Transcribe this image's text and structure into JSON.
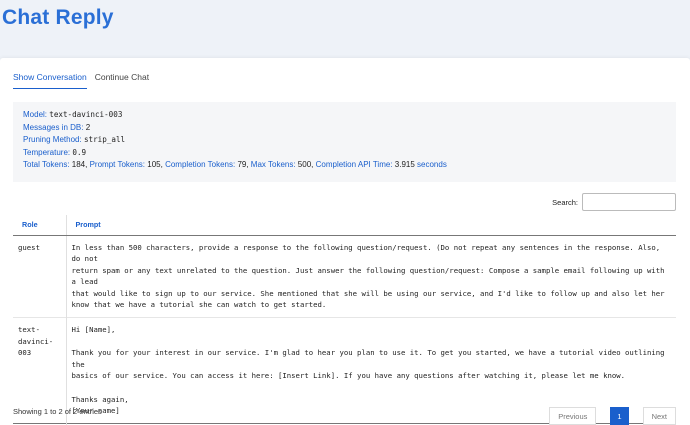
{
  "page": {
    "title": "Chat Reply"
  },
  "tabs": [
    {
      "label": "Show Conversation",
      "active": true
    },
    {
      "label": "Continue Chat",
      "active": false
    }
  ],
  "info": {
    "model_label": "Model:",
    "model_value": "text-davinci-003",
    "messages_label": "Messages in DB:",
    "messages_value": "2",
    "pruning_label": "Pruning Method:",
    "pruning_value": "strip_all",
    "temperature_label": "Temperature:",
    "temperature_value": "0.9",
    "total_tokens_label": "Total Tokens:",
    "total_tokens_value": "184,",
    "prompt_tokens_label": "Prompt Tokens:",
    "prompt_tokens_value": "105,",
    "completion_tokens_label": "Completion Tokens:",
    "completion_tokens_value": "79,",
    "max_tokens_label": "Max Tokens:",
    "max_tokens_value": "500,",
    "api_time_label": "Completion API Time:",
    "api_time_value": "3.915",
    "api_time_unit": "seconds"
  },
  "search": {
    "label": "Search:",
    "value": ""
  },
  "table": {
    "columns": [
      "Role",
      "Prompt"
    ],
    "rows": [
      {
        "role": "guest",
        "prompt": "In less than 500 characters, provide a response to the following question/request. (Do not repeat any sentences in the response. Also, do not\nreturn spam or any text unrelated to the question. Just answer the following question/request: Compose a sample email following up with a lead\nthat would like to sign up to our service. She mentioned that she will be using our service, and I'd like to follow up and also let her\nknow that we have a tutorial she can watch to get started."
      },
      {
        "role": "text-\ndavinci-\n003",
        "prompt": "Hi [Name],\n\nThank you for your interest in our service. I'm glad to hear you plan to use it. To get you started, we have a tutorial video outlining the\nbasics of our service. You can access it here: [Insert Link]. If you have any questions after watching it, please let me know.\n\nThanks again,\n[Your name]"
      }
    ]
  },
  "footer": {
    "showing": "Showing 1 to 2 of 2 entries",
    "previous": "Previous",
    "page": "1",
    "next": "Next"
  },
  "colors": {
    "accent": "#1a5fcc",
    "title": "#2a6fd6",
    "background": "#eef2f8"
  }
}
